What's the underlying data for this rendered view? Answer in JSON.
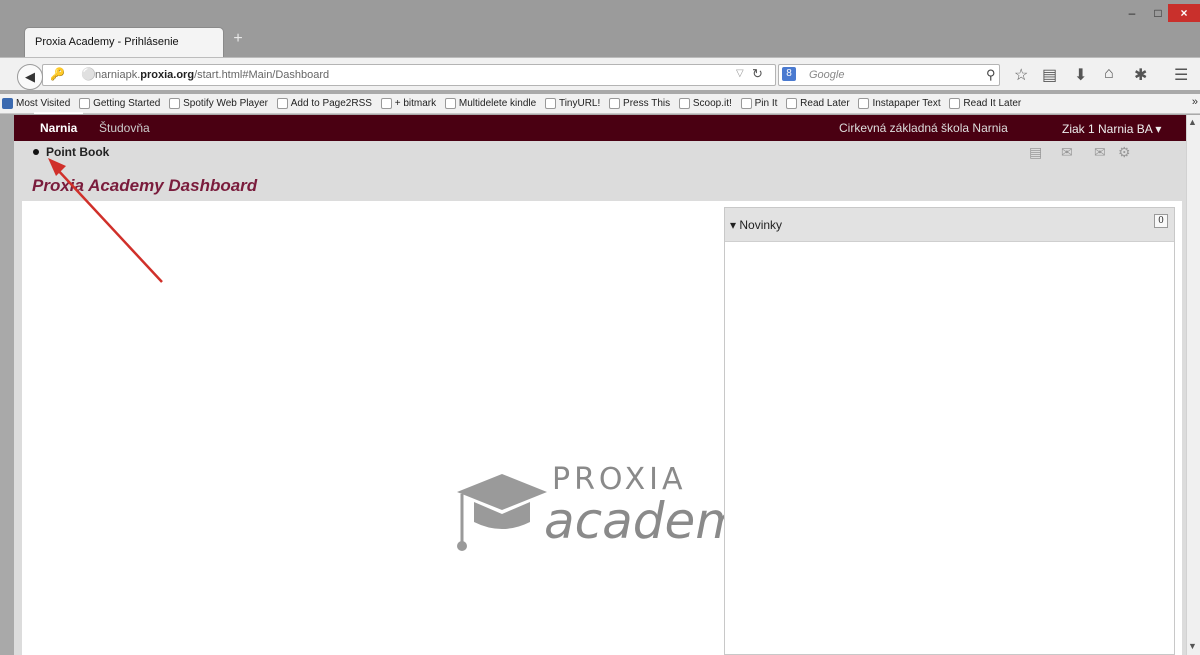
{
  "browser": {
    "tab_title": "Proxia Academy - Prihlásenie",
    "new_tab_icon": "+",
    "window_controls": {
      "minimize": "–",
      "maximize": "□",
      "close": "×"
    },
    "url_host_prefix": "narniapk.",
    "url_host": "proxia.org",
    "url_path": "/start.html#Main/Dashboard",
    "search_placeholder": "Google",
    "search_engine_icon": "8",
    "bookmarks": [
      "Most Visited",
      "Getting Started",
      "Spotify Web Player",
      "Add to Page2RSS",
      "+ bitmark",
      "Multidelete kindle",
      "TinyURL!",
      "Press This",
      "Scoop.it!",
      "Pin It",
      "Read Later",
      "Instapaper Text",
      "Read It Later"
    ],
    "bookmarks_overflow": "»"
  },
  "app": {
    "nav": {
      "items": [
        {
          "label": "Narnia",
          "active": true
        },
        {
          "label": "Študovňa",
          "active": false
        }
      ],
      "school": "Cirkevná základná škola Narnia",
      "user": "Ziak 1 Narnia BA ▾"
    },
    "subnav": {
      "item": "Point Book",
      "icons": [
        "calendar-icon",
        "add-message-icon",
        "mail-icon",
        "network-icon"
      ]
    },
    "page_title": "Proxia Academy Dashboard",
    "news": {
      "title": "▾ Novinky",
      "count": "0"
    },
    "logo": {
      "line1": "PROXIA",
      "line2": "academy"
    }
  },
  "colors": {
    "nav_bg": "#4a0012",
    "title": "#7a1c3c",
    "arrow": "#d0302a"
  }
}
